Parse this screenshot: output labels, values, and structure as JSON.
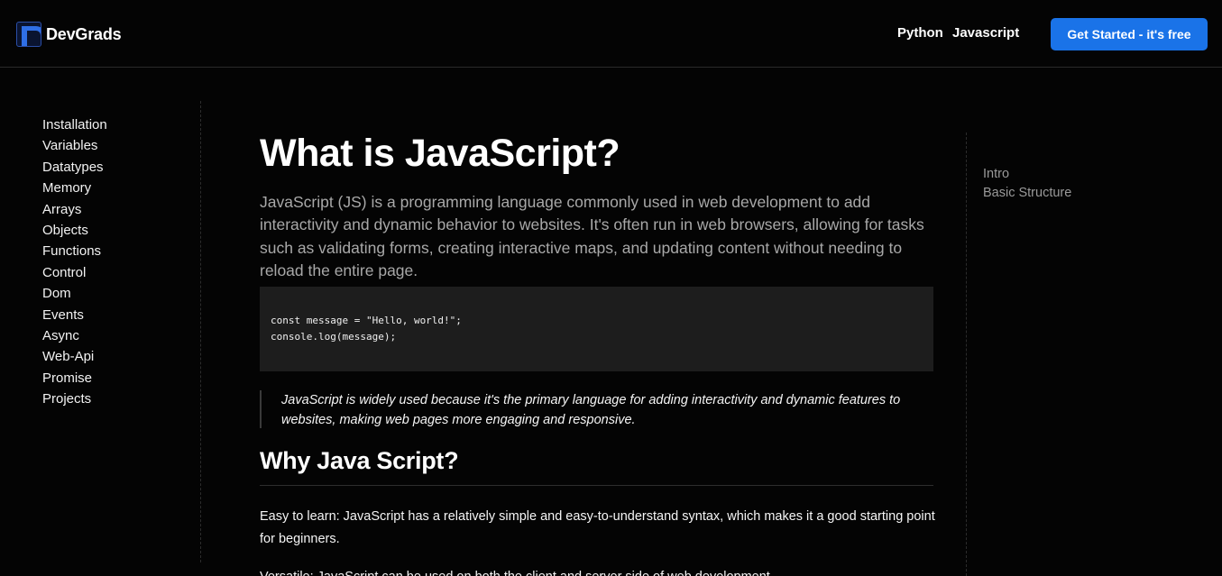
{
  "header": {
    "brand": "DevGrads",
    "nav": [
      "Python",
      "Javascript"
    ],
    "cta_label": "Get Started - it's free",
    "accent_color": "#1a73e8"
  },
  "sidebar": {
    "items": [
      "Installation",
      "Variables",
      "Datatypes",
      "Memory",
      "Arrays",
      "Objects",
      "Functions",
      "Control",
      "Dom",
      "Events",
      "Async",
      "Web-Api",
      "Promise",
      "Projects"
    ]
  },
  "main": {
    "title": "What is JavaScript?",
    "lead": "JavaScript (JS) is a programming language commonly used in web development to add interactivity and dynamic behavior to websites. It's often run in web browsers, allowing for tasks such as validating forms, creating interactive maps, and updating content without needing to reload the entire page.",
    "code": [
      "const message = \"Hello, world!\";",
      "console.log(message);"
    ],
    "quote": "JavaScript is widely used because it's the primary language for adding interactivity and dynamic features to websites, making web pages more engaging and responsive.",
    "section_title": "Why Java Script?",
    "paragraph": "Easy to learn: JavaScript has a relatively simple and easy-to-understand syntax, which makes it a good starting point for beginners.",
    "paragraph_next": "Versatile: JavaScript can be used on both the client and server side of web development."
  },
  "toc": {
    "items": [
      "Intro",
      "Basic Structure"
    ]
  }
}
